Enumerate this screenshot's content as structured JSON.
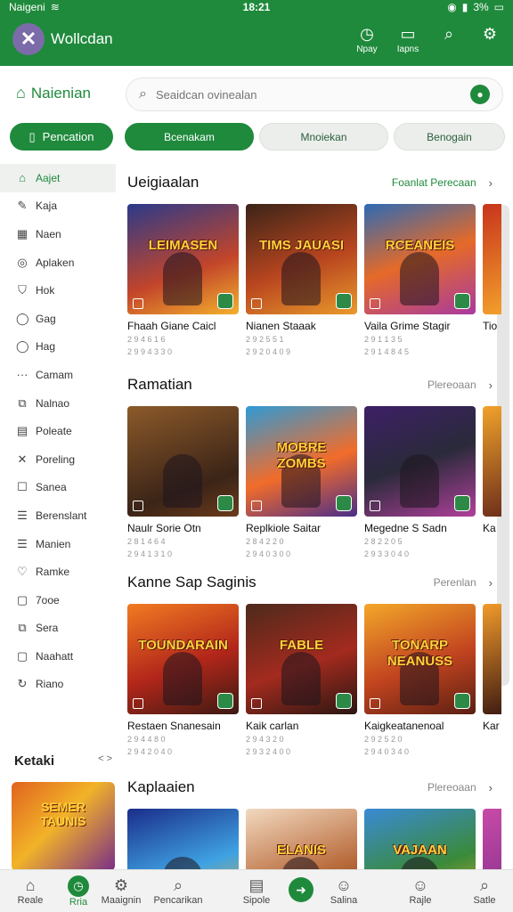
{
  "status": {
    "carrier": "Naigeni",
    "time": "18:21",
    "battery": "3%"
  },
  "header": {
    "title": "Wollcdan",
    "actions": [
      {
        "label": "Npay",
        "icon": "clock-icon"
      },
      {
        "label": "Iapns",
        "icon": "window-icon"
      },
      {
        "label": "",
        "icon": "search-icon"
      },
      {
        "label": "",
        "icon": "notification-icon"
      }
    ]
  },
  "sidebar": {
    "heading": "Naienian",
    "primary_button": "Pencation",
    "items": [
      {
        "label": "Aajet",
        "icon": "home-icon",
        "active": true
      },
      {
        "label": "Kaja",
        "icon": "pen-icon"
      },
      {
        "label": "Naen",
        "icon": "grid-icon"
      },
      {
        "label": "Aplaken",
        "icon": "disc-icon"
      },
      {
        "label": "Hok",
        "icon": "shield-icon"
      },
      {
        "label": "Gag",
        "icon": "circle-icon"
      },
      {
        "label": "Hag",
        "icon": "circle-icon"
      },
      {
        "label": "Camam",
        "icon": "dots-icon"
      },
      {
        "label": "Nalnao",
        "icon": "puzzle-icon"
      },
      {
        "label": "Poleate",
        "icon": "file-icon"
      },
      {
        "label": "Poreling",
        "icon": "cross-icon"
      },
      {
        "label": "Sanea",
        "icon": "box-icon"
      },
      {
        "label": "Berenslant",
        "icon": "list-icon"
      },
      {
        "label": "Manien",
        "icon": "list-icon"
      },
      {
        "label": "Ramke",
        "icon": "heart-icon"
      },
      {
        "label": "7ooe",
        "icon": "chat-icon"
      },
      {
        "label": "Sera",
        "icon": "puzzle-icon"
      },
      {
        "label": "Naahatt",
        "icon": "chat-icon"
      },
      {
        "label": "Riano",
        "icon": "refresh-icon"
      }
    ],
    "section_title": "Ketaki",
    "section_more": "˂ ˃",
    "thumb_text": "SEMER TAUNIS"
  },
  "search": {
    "placeholder": "Seaidcan ovinealan"
  },
  "tabs": [
    {
      "label": "Bcenakam",
      "active": true
    },
    {
      "label": "Mnoiekan",
      "active": false
    },
    {
      "label": "Benogain",
      "active": false
    }
  ],
  "sections": [
    {
      "title": "Ueigiaalan",
      "more": "Foanlat Perecaan",
      "more_green": true,
      "cards": [
        {
          "title": "Fhaah Giane Caicl",
          "meta1": "2 9 4 6 1 6",
          "meta2": "2 9 9 4 3 3 0",
          "art": "LEIMASEN"
        },
        {
          "title": "Nianen Staaak",
          "meta1": "2 9 2 5 5 1",
          "meta2": "2 9 2 0 4 0 9",
          "art": "TIMS JAUASI"
        },
        {
          "title": "Vaila Grime Stagir",
          "meta1": "2 9 1 1 3 5",
          "meta2": "2 9 1 4 8 4 5",
          "art": "RCEANEIS"
        },
        {
          "title": "Tio",
          "meta1": "",
          "meta2": "",
          "art": ""
        }
      ]
    },
    {
      "title": "Ramatian",
      "more": "Plereoaan",
      "more_green": false,
      "cards": [
        {
          "title": "Naulr Sorie Otn",
          "meta1": "2 8 1 4 6 4",
          "meta2": "2 9 4 1 3 1 0",
          "art": ""
        },
        {
          "title": "Replkiole Saitar",
          "meta1": "2 8 4 2 2 0",
          "meta2": "2 9 4 0 3 0 0",
          "art": "MOBRE ZOMBS"
        },
        {
          "title": "Megedne S Sadn",
          "meta1": "2 8 2 2 0 5",
          "meta2": "2 9 3 3 0 4 0",
          "art": ""
        },
        {
          "title": "Ka",
          "meta1": "",
          "meta2": "",
          "art": ""
        }
      ]
    },
    {
      "title": "Kanne Sap Saginis",
      "more": "Perenlan",
      "more_green": false,
      "cards": [
        {
          "title": "Restaen Snanesain",
          "meta1": "2 9 4 4 8 0",
          "meta2": "2 9 4 2 0 4 0",
          "art": "TOUNDARAIN"
        },
        {
          "title": "Kaik carlan",
          "meta1": "2 9 4 3 2 0",
          "meta2": "2 9 3 2 4 0 0",
          "art": "FABLE"
        },
        {
          "title": "Kaigkeatanenoal",
          "meta1": "2 9 2 5 2 0",
          "meta2": "2 9 4 0 3 4 0",
          "art": "TONARP NEANUSS"
        },
        {
          "title": "Kar",
          "meta1": "",
          "meta2": "",
          "art": ""
        }
      ]
    },
    {
      "title": "Kaplaaien",
      "more": "Plereoaan",
      "more_green": false,
      "cards": [
        {
          "title": "",
          "meta1": "",
          "meta2": "",
          "art": ""
        },
        {
          "title": "",
          "meta1": "",
          "meta2": "",
          "art": "ELANIS"
        },
        {
          "title": "",
          "meta1": "",
          "meta2": "",
          "art": "VAJAAN"
        },
        {
          "title": "",
          "meta1": "",
          "meta2": "",
          "art": ""
        }
      ]
    }
  ],
  "bottom_nav": [
    {
      "label": "Reale",
      "icon": "home-icon"
    },
    {
      "label": "Rria",
      "icon": "clock-icon",
      "active": true
    },
    {
      "label": "Maaignin",
      "icon": "gear-icon"
    },
    {
      "label": "Pencarikan",
      "icon": "search-icon"
    },
    {
      "label": "Sipole",
      "icon": "book-icon"
    },
    {
      "label": "",
      "icon": "play-icon"
    },
    {
      "label": "Salina",
      "icon": "person-icon"
    },
    {
      "label": "Rajle",
      "icon": "user-icon"
    },
    {
      "label": "Satle",
      "icon": "search-icon"
    }
  ],
  "colors": {
    "brand": "#1f8a3c",
    "tab_bg": "#eceeec",
    "text": "#222222"
  }
}
